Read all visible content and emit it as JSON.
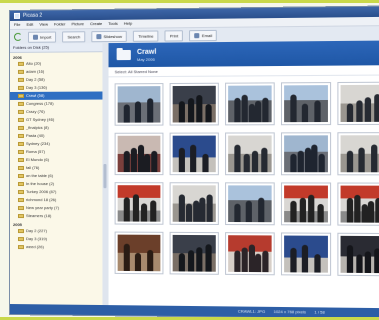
{
  "window": {
    "title": "Picasa 2"
  },
  "menu": [
    "File",
    "Edit",
    "View",
    "Folder",
    "Picture",
    "Create",
    "Tools",
    "Help"
  ],
  "toolbar": {
    "import": "Import",
    "search": "Search",
    "slideshow": "Slideshow",
    "timeline": "Timeline",
    "print": "Print",
    "email": "Email"
  },
  "sidebar": {
    "header": "Folders on Disk (25)",
    "groups": [
      {
        "label": "2006",
        "items": [
          "Alto (20)",
          "adam (16)",
          "Day 2 (58)",
          "Day 3 (136)",
          "Crawl (58)",
          "Congress (178)",
          "Crazy (76)",
          "GT Sydney (46)",
          "_finalpics (8)",
          "Pasta (40)",
          "Sydney (234)",
          "Roma (57)",
          "El Mundo (6)",
          "fall (76)",
          "on the table (6)",
          "In the house (2)",
          "Turkey 2006 (87)",
          "richmond 18 (26)",
          "New year party (7)",
          "Steamers (18)"
        ]
      },
      {
        "label": "2005",
        "items": [
          "Day 2 (227)",
          "Day 3 (319)",
          "weed (26)"
        ]
      }
    ],
    "selected_index": 4
  },
  "album": {
    "title": "Crawl",
    "date": "May 2006",
    "select_hint": "Select: All  Starred  None"
  },
  "thumbnails": [
    {
      "theme": "people-sky"
    },
    {
      "theme": "people-dark"
    },
    {
      "theme": "crowd-sky"
    },
    {
      "theme": "crowd-sky"
    },
    {
      "theme": "people-light"
    },
    {
      "theme": "people-red"
    },
    {
      "theme": "people-blue"
    },
    {
      "theme": "people-light"
    },
    {
      "theme": "people-sky"
    },
    {
      "theme": "people-light"
    },
    {
      "theme": "red-banner"
    },
    {
      "theme": "people-light"
    },
    {
      "theme": "crowd-sky"
    },
    {
      "theme": "red-banner"
    },
    {
      "theme": "red-banner"
    },
    {
      "theme": "brown-room"
    },
    {
      "theme": "people-dark"
    },
    {
      "theme": "red-room"
    },
    {
      "theme": "people-blue"
    },
    {
      "theme": "stage-dark"
    }
  ],
  "status": {
    "info": "CRAWL1: JPG",
    "size": "1024 x 768 pixels",
    "count": "1 / 58"
  },
  "colors": {
    "accent": "#2f6fc2",
    "header": "#1f57a6",
    "frame": "#c9d84a"
  }
}
